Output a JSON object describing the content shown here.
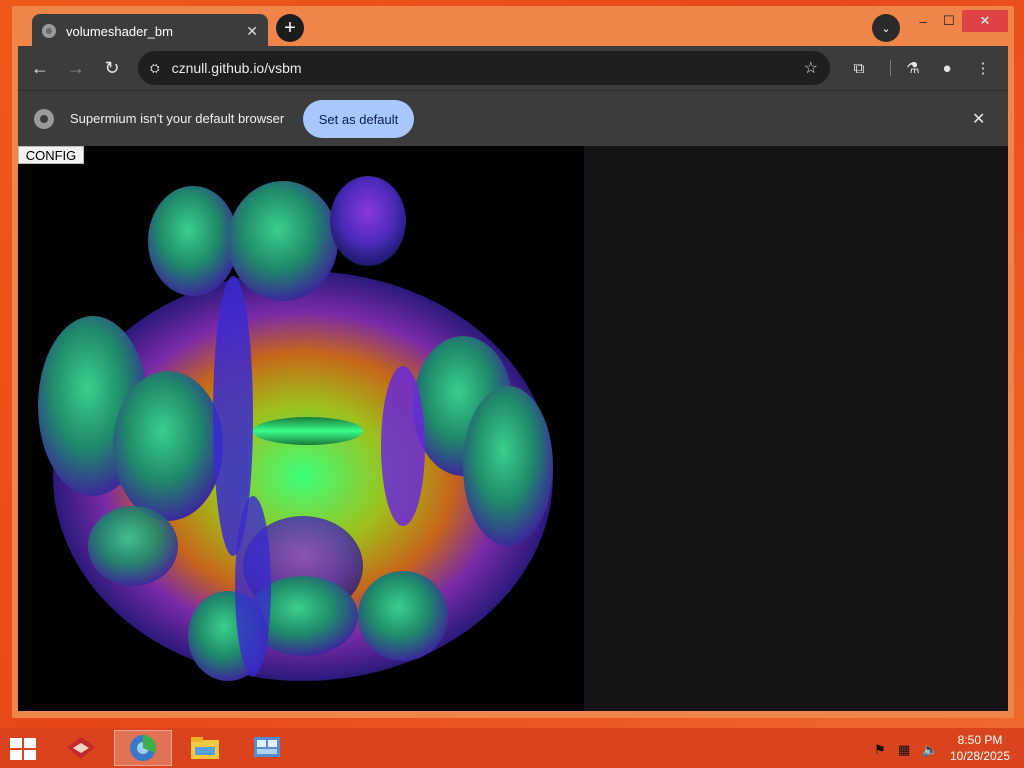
{
  "tab": {
    "title": "volumeshader_bm",
    "close": "✕",
    "newtab": "+"
  },
  "tabsearch": "⌄",
  "window_controls": {
    "minimize": "–",
    "maximize": "☐",
    "close": "✕"
  },
  "toolbar": {
    "back": "←",
    "forward": "→",
    "reload": "↻",
    "site_info": "⛭",
    "url": "cznull.github.io/vsbm",
    "bookmark": "☆",
    "extensions": "⧉",
    "labs": "⚗",
    "profile": "●",
    "menu": "⋮"
  },
  "infobar": {
    "message": "Supermium isn't your default browser",
    "button": "Set as default",
    "close": "✕"
  },
  "page": {
    "config_button": "CONFIG"
  },
  "taskbar": {
    "time": "8:50 PM",
    "date": "10/28/2025",
    "icons": [
      "windows-start-icon",
      "app-icon",
      "browser-icon",
      "file-explorer-icon",
      "control-panel-icon"
    ]
  },
  "colors": {
    "desktop": "#e8481a",
    "taskbar": "#d9431d",
    "window_frame": "#f0854a",
    "toolbar": "#3c3c3c",
    "accent_button": "#a8c7fa"
  }
}
